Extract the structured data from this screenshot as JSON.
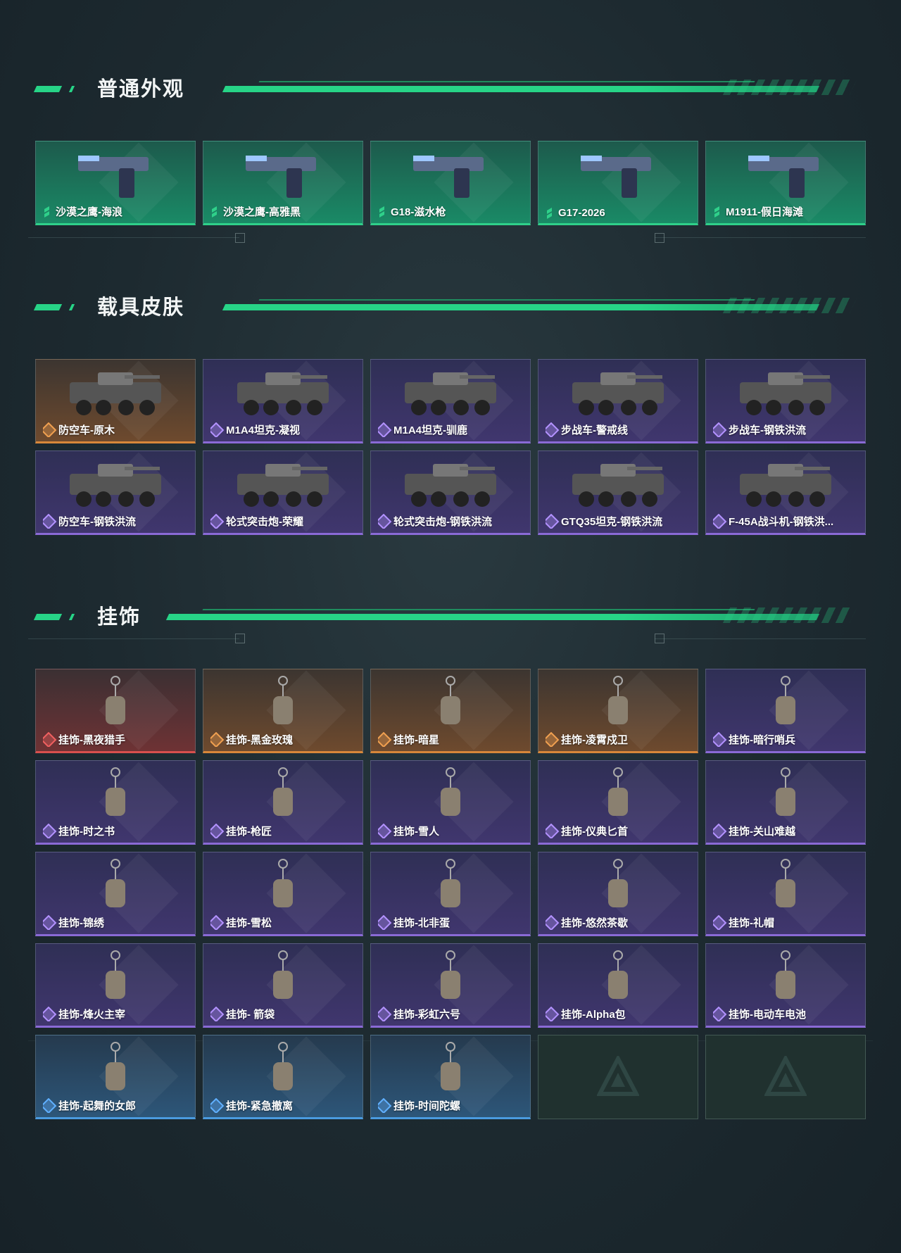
{
  "sections": {
    "skins": {
      "title": "普通外观",
      "items": [
        {
          "label": "沙漠之鹰-海浪",
          "rarity": "green"
        },
        {
          "label": "沙漠之鹰-高雅黑",
          "rarity": "green"
        },
        {
          "label": "G18-滋水枪",
          "rarity": "green"
        },
        {
          "label": "G17-2026",
          "rarity": "green"
        },
        {
          "label": "M1911-假日海滩",
          "rarity": "green"
        }
      ]
    },
    "vehicles": {
      "title": "载具皮肤",
      "items": [
        {
          "label": "防空车-原木",
          "rarity": "orange"
        },
        {
          "label": "M1A4坦克-凝视",
          "rarity": "purple"
        },
        {
          "label": "M1A4坦克-驯鹿",
          "rarity": "purple"
        },
        {
          "label": "步战车-警戒线",
          "rarity": "purple"
        },
        {
          "label": "步战车-钢铁洪流",
          "rarity": "purple"
        },
        {
          "label": "防空车-钢铁洪流",
          "rarity": "purple"
        },
        {
          "label": "轮式突击炮-荣耀",
          "rarity": "purple"
        },
        {
          "label": "轮式突击炮-钢铁洪流",
          "rarity": "purple"
        },
        {
          "label": "GTQ35坦克-钢铁洪流",
          "rarity": "purple"
        },
        {
          "label": "F-45A战斗机-钢铁洪...",
          "rarity": "purple"
        }
      ]
    },
    "charms": {
      "title": "挂饰",
      "items": [
        {
          "label": "挂饰-黑夜猎手",
          "rarity": "red"
        },
        {
          "label": "挂饰-黑金玫瑰",
          "rarity": "orange"
        },
        {
          "label": "挂饰-暗星",
          "rarity": "orange"
        },
        {
          "label": "挂饰-凌霄戍卫",
          "rarity": "orange"
        },
        {
          "label": "挂饰-暗行哨兵",
          "rarity": "purple"
        },
        {
          "label": "挂饰-时之书",
          "rarity": "purple"
        },
        {
          "label": "挂饰-枪匠",
          "rarity": "purple"
        },
        {
          "label": "挂饰-雪人",
          "rarity": "purple"
        },
        {
          "label": "挂饰-仪典匕首",
          "rarity": "purple"
        },
        {
          "label": "挂饰-关山难越",
          "rarity": "purple"
        },
        {
          "label": "挂饰-锦绣",
          "rarity": "purple"
        },
        {
          "label": "挂饰-雪松",
          "rarity": "purple"
        },
        {
          "label": "挂饰-北非蛋",
          "rarity": "purple"
        },
        {
          "label": "挂饰-悠然茶歇",
          "rarity": "purple"
        },
        {
          "label": "挂饰-礼帽",
          "rarity": "purple"
        },
        {
          "label": "挂饰-烽火主宰",
          "rarity": "purple"
        },
        {
          "label": "挂饰- 箭袋",
          "rarity": "purple"
        },
        {
          "label": "挂饰-彩虹六号",
          "rarity": "purple"
        },
        {
          "label": "挂饰-Alpha包",
          "rarity": "purple"
        },
        {
          "label": "挂饰-电动车电池",
          "rarity": "purple"
        },
        {
          "label": "挂饰-起舞的女郎",
          "rarity": "blue"
        },
        {
          "label": "挂饰-紧急撤离",
          "rarity": "blue"
        },
        {
          "label": "挂饰-时间陀螺",
          "rarity": "blue"
        }
      ]
    }
  },
  "colors": {
    "accent": "#27d487",
    "green": "#2fd08a",
    "purple": "#8a6ad6",
    "orange": "#d8873a",
    "red": "#d8504e",
    "blue": "#4a9be0"
  }
}
